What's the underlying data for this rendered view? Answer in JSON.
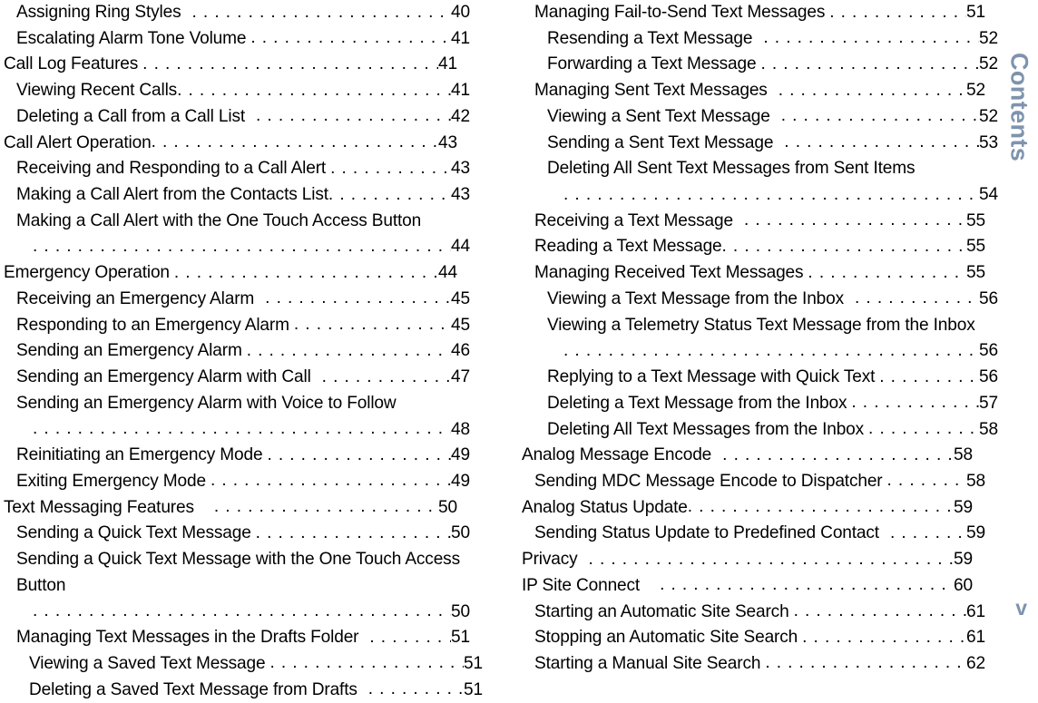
{
  "page": {
    "folio": "v",
    "side_tab_label": "Contents",
    "accent_color": "#7e93ae",
    "text_color": "#000000",
    "background_color": "#ffffff"
  },
  "columns": [
    {
      "id": "left",
      "entries": [
        {
          "level": 2,
          "title": "Assigning Ring Styles",
          "page": "40",
          "wrapped": false,
          "gap": "m"
        },
        {
          "level": 2,
          "title": "Escalating Alarm Tone Volume",
          "page": "41",
          "wrapped": false,
          "gap": "s"
        },
        {
          "level": 1,
          "title": "Call Log Features",
          "page": "41",
          "wrapped": false,
          "gap": "s"
        },
        {
          "level": 2,
          "title": "Viewing Recent Calls",
          "page": "41",
          "wrapped": false,
          "gap": "none"
        },
        {
          "level": 2,
          "title": "Deleting a Call from a Call List",
          "page": "42",
          "wrapped": false,
          "gap": "m"
        },
        {
          "level": 1,
          "title": "Call Alert Operation",
          "page": "43",
          "wrapped": false,
          "gap": "none"
        },
        {
          "level": 2,
          "title": "Receiving and Responding to a Call Alert",
          "page": "43",
          "wrapped": false,
          "gap": "s"
        },
        {
          "level": 2,
          "title": "Making a Call Alert from the Contacts List",
          "page": "43",
          "wrapped": false,
          "gap": "none"
        },
        {
          "level": 2,
          "title": "Making a Call Alert with the One Touch Access Button",
          "page": "44",
          "wrapped": true,
          "gap": "none"
        },
        {
          "level": 1,
          "title": "Emergency Operation",
          "page": "44",
          "wrapped": false,
          "gap": "s"
        },
        {
          "level": 2,
          "title": "Receiving an Emergency Alarm",
          "page": "45",
          "wrapped": false,
          "gap": "m"
        },
        {
          "level": 2,
          "title": "Responding to an Emergency Alarm",
          "page": "45",
          "wrapped": false,
          "gap": "s"
        },
        {
          "level": 2,
          "title": "Sending an Emergency Alarm",
          "page": "46",
          "wrapped": false,
          "gap": "s"
        },
        {
          "level": 2,
          "title": "Sending an Emergency Alarm with Call",
          "page": "47",
          "wrapped": false,
          "gap": "m"
        },
        {
          "level": 2,
          "title": "Sending an Emergency Alarm with Voice to Follow",
          "page": "48",
          "wrapped": true,
          "gap": "none"
        },
        {
          "level": 2,
          "title": "Reinitiating an Emergency Mode",
          "page": "49",
          "wrapped": false,
          "gap": "s"
        },
        {
          "level": 2,
          "title": "Exiting Emergency Mode",
          "page": "49",
          "wrapped": false,
          "gap": "s"
        },
        {
          "level": 1,
          "title": "Text Messaging Features",
          "page": "50",
          "wrapped": false,
          "gap": "l"
        },
        {
          "level": 2,
          "title": "Sending a Quick Text Message",
          "page": "50",
          "wrapped": false,
          "gap": "s"
        },
        {
          "level": 2,
          "title": "Sending a Quick Text Message with the One Touch Access Button",
          "page": "50",
          "wrapped": true,
          "gap": "s"
        },
        {
          "level": 2,
          "title": "Managing Text Messages in the Drafts Folder",
          "page": "51",
          "wrapped": false,
          "gap": "m"
        },
        {
          "level": 3,
          "title": "Viewing a Saved Text Message",
          "page": "51",
          "wrapped": false,
          "gap": "s"
        },
        {
          "level": 3,
          "title": "Deleting a Saved Text Message from Drafts",
          "page": "51",
          "wrapped": false,
          "gap": "m"
        }
      ]
    },
    {
      "id": "right",
      "entries": [
        {
          "level": 2,
          "title": "Managing Fail-to-Send Text Messages",
          "page": "51",
          "wrapped": false,
          "gap": "s"
        },
        {
          "level": 3,
          "title": "Resending a Text Message",
          "page": "52",
          "wrapped": false,
          "gap": "m"
        },
        {
          "level": 3,
          "title": "Forwarding a Text Message",
          "page": "52",
          "wrapped": false,
          "gap": "s"
        },
        {
          "level": 2,
          "title": "Managing Sent Text Messages",
          "page": "52",
          "wrapped": false,
          "gap": "m"
        },
        {
          "level": 3,
          "title": "Viewing a Sent Text Message",
          "page": "52",
          "wrapped": false,
          "gap": "m"
        },
        {
          "level": 3,
          "title": "Sending a Sent Text Message",
          "page": "53",
          "wrapped": false,
          "gap": "m"
        },
        {
          "level": 3,
          "title": "Deleting All Sent Text Messages from Sent Items",
          "page": "54",
          "wrapped": true,
          "gap": "none"
        },
        {
          "level": 2,
          "title": "Receiving a Text Message",
          "page": "55",
          "wrapped": false,
          "gap": "m"
        },
        {
          "level": 2,
          "title": "Reading a Text Message",
          "page": "55",
          "wrapped": false,
          "gap": "none"
        },
        {
          "level": 2,
          "title": "Managing Received Text Messages",
          "page": "55",
          "wrapped": false,
          "gap": "s"
        },
        {
          "level": 3,
          "title": "Viewing a Text Message from the Inbox",
          "page": "56",
          "wrapped": false,
          "gap": "m"
        },
        {
          "level": 3,
          "title": "Viewing a Telemetry Status Text Message from the Inbox",
          "page": "56",
          "wrapped": true,
          "gap": "none"
        },
        {
          "level": 3,
          "title": "Replying to a Text Message with Quick Text",
          "page": "56",
          "wrapped": false,
          "gap": "s"
        },
        {
          "level": 3,
          "title": "Deleting a Text Message from the Inbox",
          "page": "57",
          "wrapped": false,
          "gap": "s"
        },
        {
          "level": 3,
          "title": "Deleting All Text Messages from the Inbox",
          "page": "58",
          "wrapped": false,
          "gap": "s"
        },
        {
          "level": 1,
          "title": "Analog Message Encode",
          "page": "58",
          "wrapped": false,
          "gap": "m"
        },
        {
          "level": 2,
          "title": "Sending MDC Message Encode to Dispatcher",
          "page": "58",
          "wrapped": false,
          "gap": "s"
        },
        {
          "level": 1,
          "title": "Analog Status Update",
          "page": "59",
          "wrapped": false,
          "gap": "none"
        },
        {
          "level": 2,
          "title": "Sending Status Update to Predefined Contact",
          "page": "59",
          "wrapped": false,
          "gap": "m"
        },
        {
          "level": 1,
          "title": "Privacy",
          "page": "59",
          "wrapped": false,
          "gap": "m"
        },
        {
          "level": 1,
          "title": "IP Site Connect",
          "page": "60",
          "wrapped": false,
          "gap": "l"
        },
        {
          "level": 2,
          "title": "Starting an Automatic Site Search",
          "page": "61",
          "wrapped": false,
          "gap": "s"
        },
        {
          "level": 2,
          "title": "Stopping an Automatic Site Search",
          "page": "61",
          "wrapped": false,
          "gap": "s"
        },
        {
          "level": 2,
          "title": "Starting a Manual Site Search",
          "page": "62",
          "wrapped": false,
          "gap": "s"
        }
      ]
    }
  ]
}
